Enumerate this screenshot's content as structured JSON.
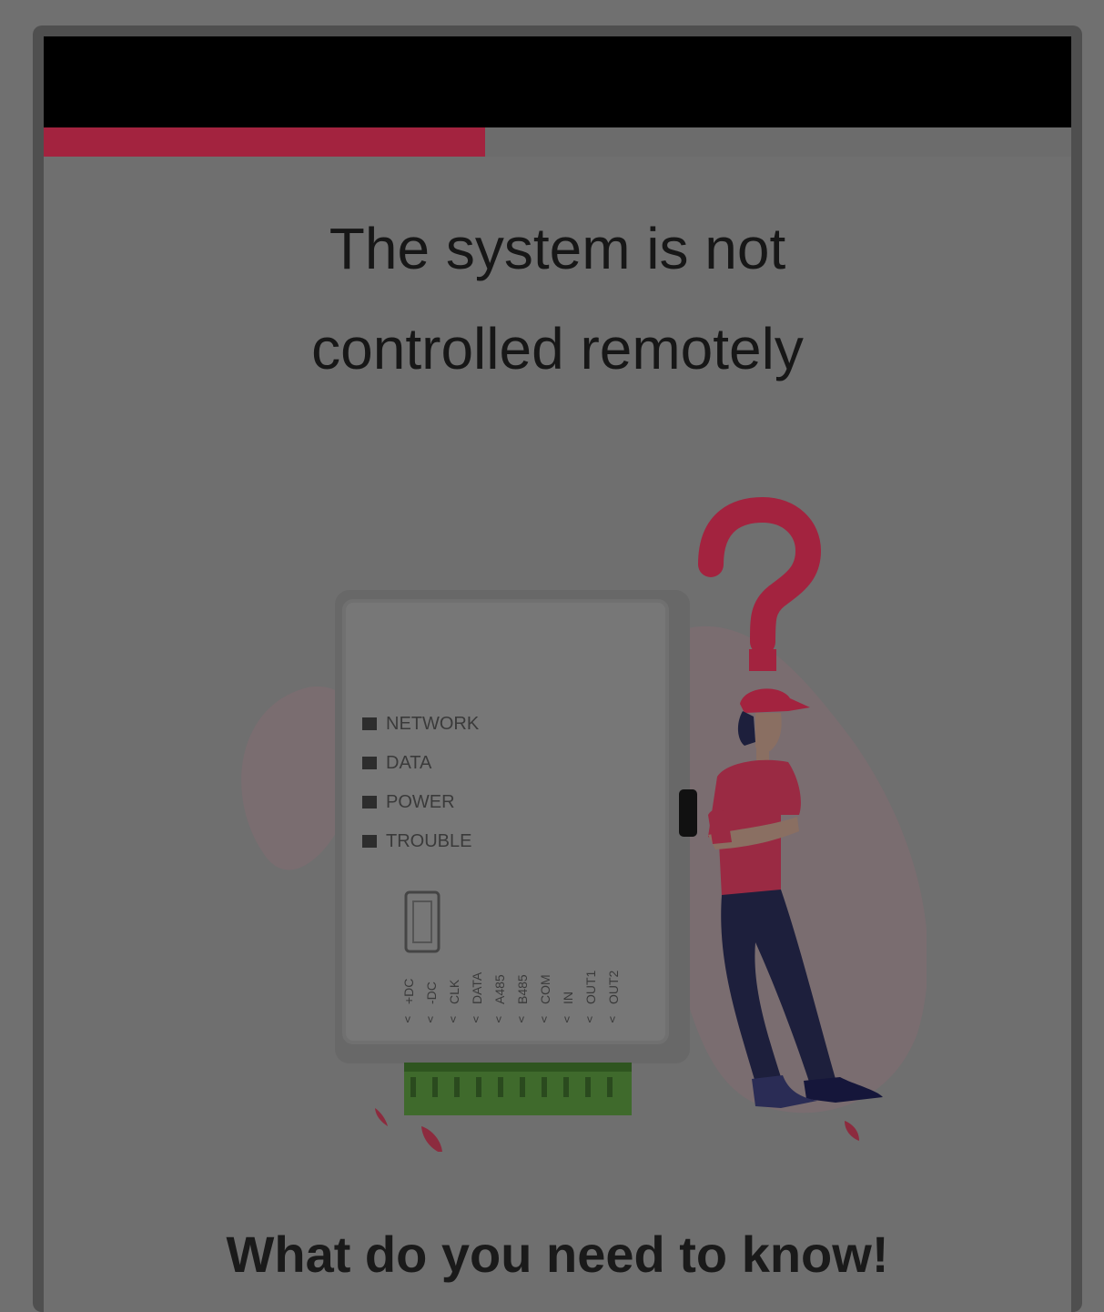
{
  "colors": {
    "accent": "#a3233f",
    "overlay_background": "#707070",
    "status_bar": "#000000",
    "connector_green": "#3f6a2c"
  },
  "progress": {
    "fraction": 0.43
  },
  "main": {
    "title": "The system is not\ncontrolled remotely",
    "subtitle": "What do you need to know!"
  },
  "illustration": {
    "icon": "question-mark-icon",
    "led_labels": [
      "NETWORK",
      "DATA",
      "POWER",
      "TROUBLE"
    ],
    "terminal_labels": [
      "+DC",
      "-DC",
      "CLK",
      "DATA",
      "A485",
      "B485",
      "COM",
      "IN",
      "OUT1",
      "OUT2"
    ]
  }
}
